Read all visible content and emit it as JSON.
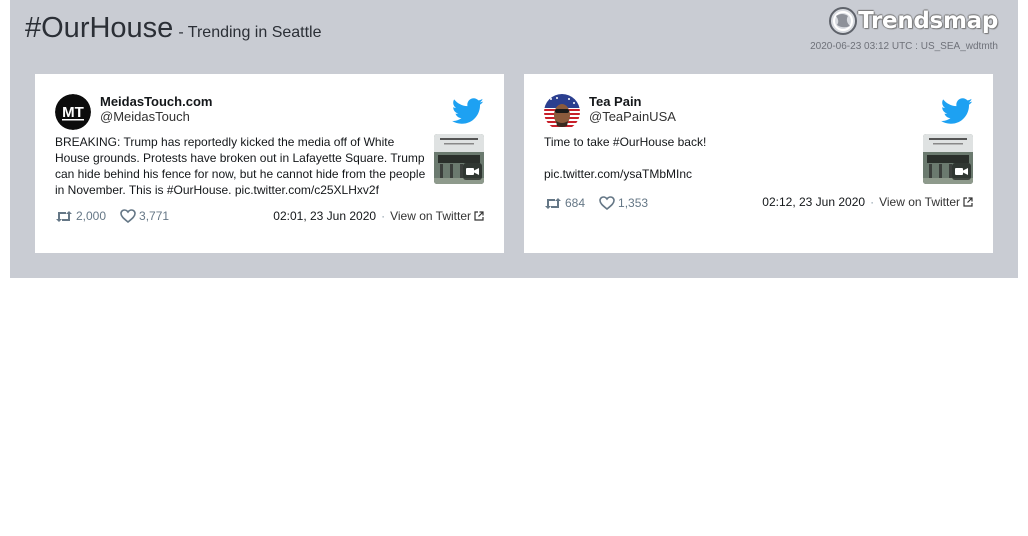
{
  "header": {
    "hashtag": "#OurHouse",
    "subtitle": "- Trending in Seattle",
    "brand": "Trendsmap",
    "meta": "2020-06-23 03:12 UTC : US_SEA_wdtmth"
  },
  "colors": {
    "panel_bg": "#c9ccd3",
    "twitter_blue": "#1da1f2",
    "text_dark": "#14171a",
    "muted": "#657786"
  },
  "tweets": [
    {
      "name": "MeidasTouch.com",
      "handle": "@MeidasTouch",
      "avatar_initials": "MT",
      "text": "BREAKING: Trump has reportedly kicked the media off of White House grounds. Protests have broken out in Lafayette Square. Trump can hide behind his fence for now, but he cannot hide from the people in November. This is #OurHouse. pic.twitter.com/c25XLHxv2f",
      "retweets": "2,000",
      "likes": "3,771",
      "date": "02:01, 23 Jun 2020",
      "view_label": "View on Twitter"
    },
    {
      "name": "Tea Pain",
      "handle": "@TeaPainUSA",
      "text_line1": "Time to take #OurHouse back!",
      "text_line2": "pic.twitter.com/ysaTMbMInc",
      "retweets": "684",
      "likes": "1,353",
      "date": "02:12, 23 Jun 2020",
      "view_label": "View on Twitter"
    }
  ],
  "icons": {
    "brand": "trendsmap-logo-icon",
    "bird": "twitter-bird-icon",
    "retweet": "retweet-icon",
    "like": "heart-icon",
    "external": "external-link-icon",
    "video": "video-camera-icon"
  }
}
